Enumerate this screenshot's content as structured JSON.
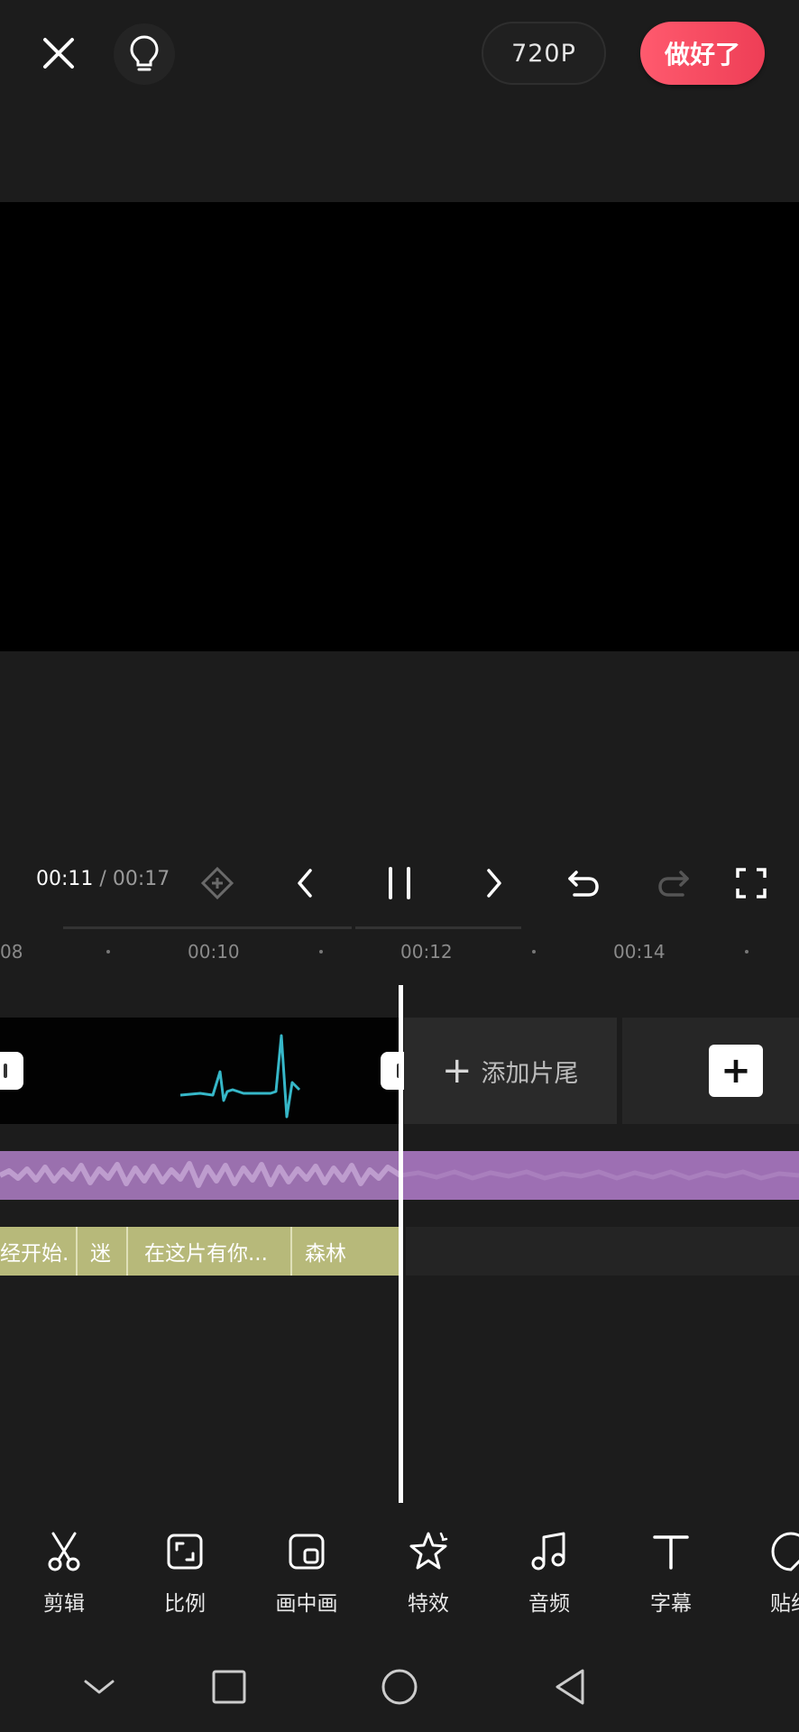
{
  "topbar": {
    "resolution_label": "720P",
    "done_label": "做好了",
    "accent": "#f04a5e"
  },
  "player": {
    "current_time": "00:11",
    "separator": "/",
    "total_time": "00:17"
  },
  "ruler": {
    "ticks": [
      "08",
      "00:10",
      "00:12",
      "00:14"
    ]
  },
  "timeline": {
    "add_end_label": "添加片尾",
    "add_clip_symbol": "+",
    "captions": [
      "经开始.",
      "迷",
      "在这片有你...",
      "森林"
    ],
    "audio_color": "#9d6fb3",
    "caption_color": "#b7b97a"
  },
  "toolbar": {
    "items": [
      {
        "label": "剪辑",
        "icon": "scissors-icon"
      },
      {
        "label": "比例",
        "icon": "aspect-ratio-icon"
      },
      {
        "label": "画中画",
        "icon": "picture-in-picture-icon"
      },
      {
        "label": "特效",
        "icon": "effects-star-icon"
      },
      {
        "label": "音频",
        "icon": "music-note-icon"
      },
      {
        "label": "字幕",
        "icon": "text-t-icon"
      },
      {
        "label": "贴纸",
        "icon": "sticker-icon"
      }
    ]
  }
}
